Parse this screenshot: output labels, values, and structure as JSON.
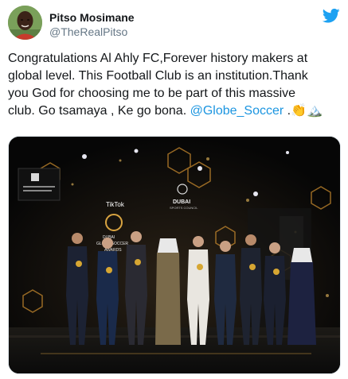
{
  "tweet": {
    "author_name": "Pitso Mosimane",
    "author_handle": "@TheRealPitso",
    "text_lines": [
      "Congratulations  Al Ahly FC,Forever history makers at",
      "global level. This Football Club is an institution.Thank",
      "you God for choosing me to be part of this massive"
    ],
    "text_last_line_prefix": "club. Go tsamaya , Ke go bona.  ",
    "mention": "@Globe_Soccer",
    "text_suffix": " .👏🏔️",
    "icons": {
      "logo": "twitter-bird-icon",
      "avatar": "profile-avatar"
    },
    "colors": {
      "brand": "#1da1f2",
      "mention": "#1b95e0",
      "text": "#14171a",
      "secondary": "#657786"
    }
  },
  "photo": {
    "stage_sign_brand": "TikTok",
    "stage_sign_lines": [
      "DUBAI",
      "GLOBE SOCCER",
      "AWARDS"
    ],
    "right_sign_line1": "DUBAI",
    "right_sign_line2": "SPORTS COUNCIL"
  }
}
